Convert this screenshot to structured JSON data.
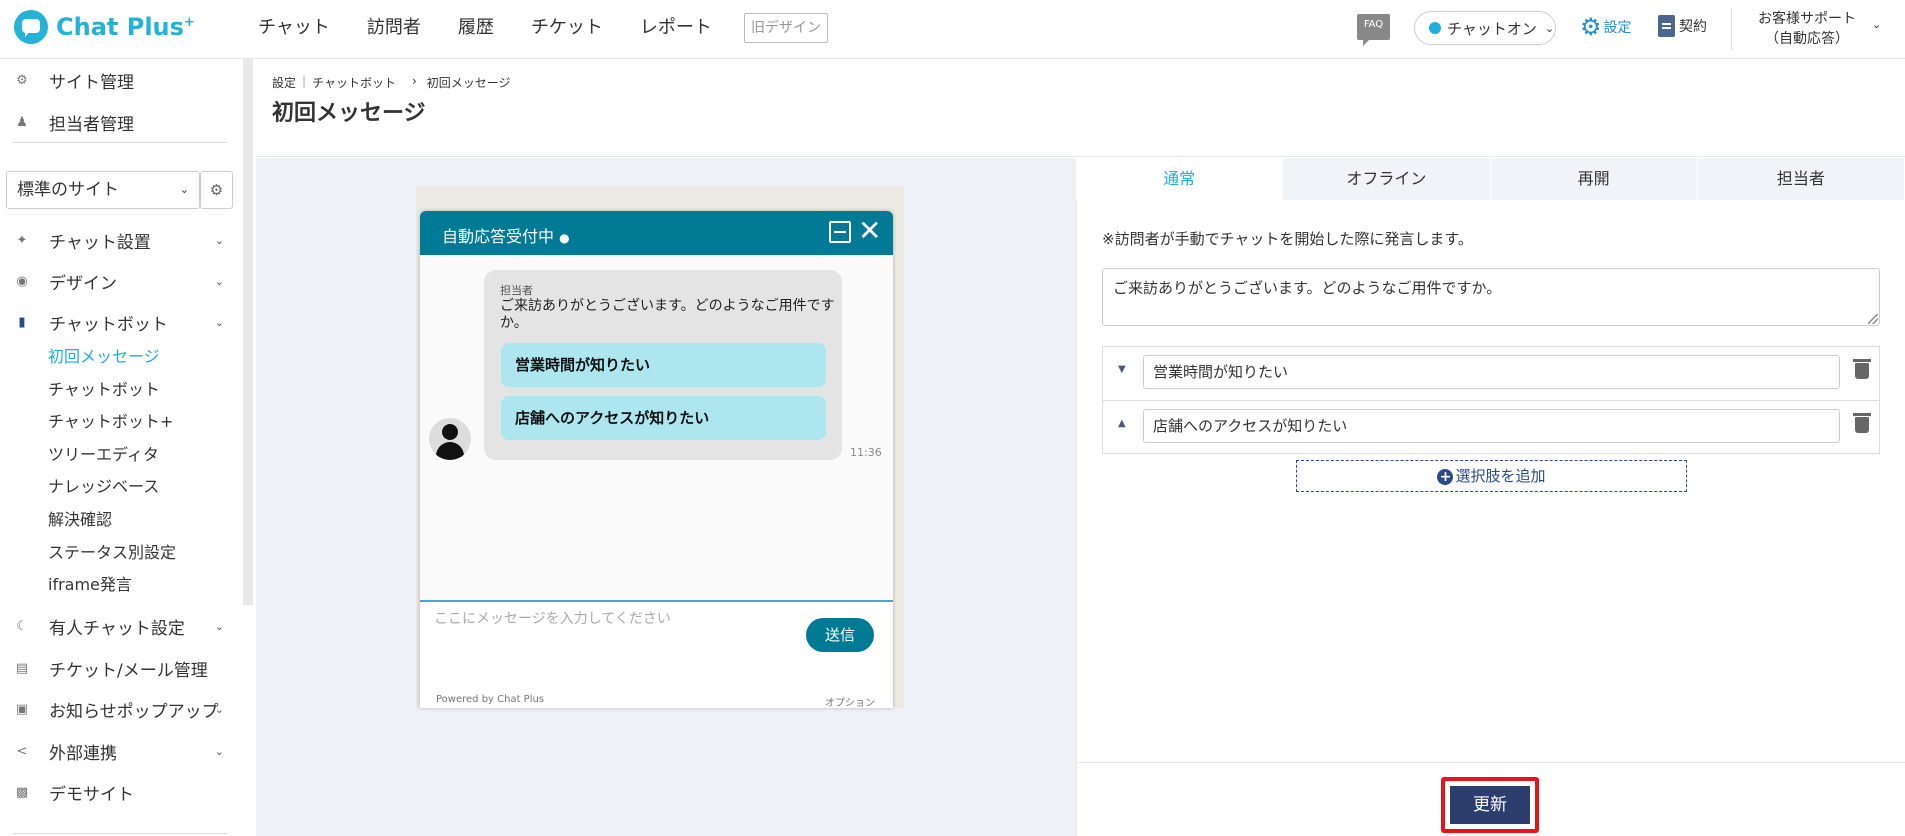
{
  "app": {
    "logo_text": "Chat Plus",
    "logo_sup": "+"
  },
  "nav": {
    "items": [
      "チャット",
      "訪問者",
      "履歴",
      "チケット",
      "レポート"
    ],
    "old_design": "旧デザイン"
  },
  "header_right": {
    "faq": "FAQ",
    "chat_status": "チャットオン",
    "chat_status_color": "#1eaee0",
    "settings": "設定",
    "contract": "契約",
    "support_line1": "お客様サポート",
    "support_line2": "（自動応答）"
  },
  "sidebar": {
    "top_items": [
      {
        "label": "サイト管理",
        "icon": "site-gear-icon"
      },
      {
        "label": "担当者管理",
        "icon": "users-icon"
      }
    ],
    "site_select": "標準のサイト",
    "menu": [
      {
        "label": "チャット設置",
        "icon": "tools-icon"
      },
      {
        "label": "デザイン",
        "icon": "palette-icon"
      },
      {
        "label": "チャットボット",
        "icon": "chat-bubbles-icon"
      }
    ],
    "chatbot_sub": [
      "初回メッセージ",
      "チャットボット",
      "チャットボット+",
      "ツリーエディタ",
      "ナレッジベース",
      "解決確認",
      "ステータス別設定",
      "iframe発言"
    ],
    "menu_bottom": [
      {
        "label": "有人チャット設定",
        "icon": "headset-icon"
      },
      {
        "label": "チケット/メール管理",
        "icon": "list-icon"
      },
      {
        "label": "お知らせポップアップ",
        "icon": "popup-icon"
      },
      {
        "label": "外部連携",
        "icon": "share-icon"
      },
      {
        "label": "デモサイト",
        "icon": "window-icon"
      }
    ]
  },
  "breadcrumb": [
    "設定",
    "|",
    "チャットボット",
    "›",
    "初回メッセージ"
  ],
  "page_title": "初回メッセージ",
  "preview": {
    "title": "自動応答受付中",
    "agent_name": "担当者",
    "message": "ご来訪ありがとうございます。どのようなご用件ですか。",
    "choices": [
      "営業時間が知りたい",
      "店舗へのアクセスが知りたい"
    ],
    "time": "11:36",
    "input_placeholder": "ここにメッセージを入力してください",
    "send": "送信",
    "powered": "Powered by Chat Plus",
    "option": "オプション",
    "accent_color": "#007a95"
  },
  "tabs": [
    "通常",
    "オフライン",
    "再開",
    "担当者"
  ],
  "note": "※訪問者が手動でチャットを開始した際に発言します。",
  "message_value": "ご来訪ありがとうございます。どのようなご用件ですか。",
  "choice_values": [
    "営業時間が知りたい",
    "店舗へのアクセスが知りたい"
  ],
  "add_choice": "選択肢を追加",
  "update_button": "更新"
}
